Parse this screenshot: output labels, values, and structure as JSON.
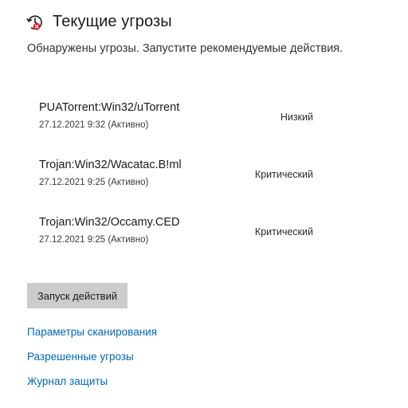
{
  "header": {
    "icon": "threat-history-icon",
    "title": "Текущие угрозы",
    "subtitle": "Обнаружены угрозы. Запустите рекомендуемые действия."
  },
  "threats": [
    {
      "name": "PUATorrent:Win32/uTorrent",
      "meta": "27.12.2021 9:32 (Активно)",
      "level": "Низкий"
    },
    {
      "name": "Trojan:Win32/Wacatac.B!ml",
      "meta": "27.12.2021 9:25 (Активно)",
      "level": "Критический"
    },
    {
      "name": "Trojan:Win32/Occamy.CED",
      "meta": "27.12.2021 9:25 (Активно)",
      "level": "Критический"
    }
  ],
  "actions": {
    "start_label": "Запуск действий"
  },
  "links": {
    "scan_options": "Параметры сканирования",
    "allowed_threats": "Разрешенные угрозы",
    "protection_history": "Журнал защиты"
  },
  "colors": {
    "link": "#0067b8",
    "button_bg": "#cccccc",
    "alert_red": "#e81123"
  }
}
